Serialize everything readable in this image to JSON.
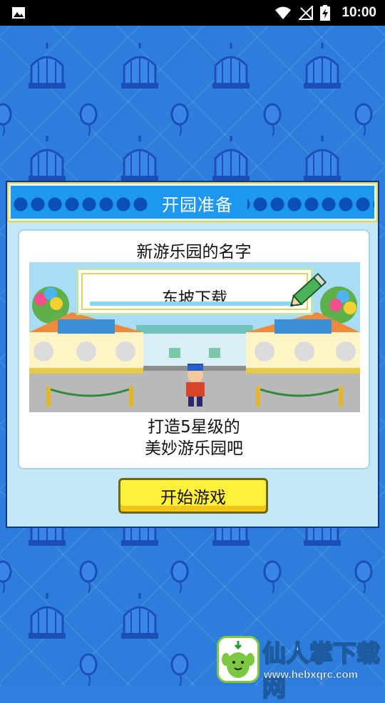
{
  "status_bar": {
    "time": "10:00",
    "icons": [
      "image-icon",
      "wifi-icon",
      "signal-icon",
      "battery-charging-icon"
    ]
  },
  "dialog": {
    "title": "开园准备",
    "card_title": "新游乐园的名字",
    "park_name": "东坡下载",
    "description_line1": "打造5星级的",
    "description_line2": "美妙游乐园吧",
    "start_button": "开始游戏"
  },
  "watermark": {
    "title": "仙人掌下载网",
    "url": "www.hebxqrc.com"
  },
  "colors": {
    "background": "#2d7ddd",
    "dialog_header": "#1d97f0",
    "button": "#fff13b",
    "button_shadow": "#f3c318"
  }
}
